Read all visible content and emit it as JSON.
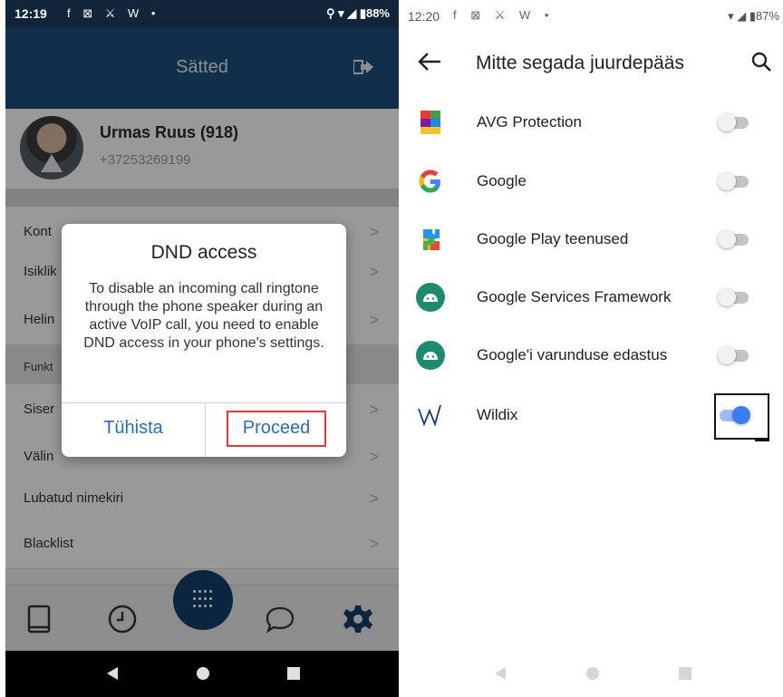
{
  "left_phone": {
    "status_bar": {
      "time": "12:19",
      "icons": "f ⊠ ⚔ W •",
      "right": "⚲ ▾ ◢ ▮88%"
    },
    "app_bar": {
      "title": "Sätted"
    },
    "profile": {
      "name": "Urmas Ruus (918)",
      "phone": "+37253269199"
    },
    "rows": [
      {
        "label": "Kont"
      },
      {
        "label": "Isiklik"
      },
      {
        "label": "Helin"
      }
    ],
    "section_label": "Funkt",
    "rows2": [
      {
        "label": "Siser"
      },
      {
        "label": "Välin"
      },
      {
        "label": "Lubatud nimekiri"
      },
      {
        "label": "Blacklist"
      }
    ],
    "dialog": {
      "title": "DND access",
      "body": "To disable an incoming call ringtone through the phone speaker during an active VoIP call, you need to enable DND access in your phone's settings.",
      "cancel_label": "Tühista",
      "proceed_label": "Proceed"
    },
    "tabs": [
      "book-icon",
      "clock-icon",
      "dialpad-icon",
      "chat-icon",
      "gear-icon"
    ],
    "colors": {
      "app_bar": "#1d4f7d",
      "status_bar": "#11243a",
      "fab": "#123f66",
      "highlight": "#e0383c"
    }
  },
  "right_phone": {
    "status_bar": {
      "time": "12:20",
      "icons": "f ⊠ ⚔ W •",
      "right": "▾ ◢ ▮87%"
    },
    "app_bar": {
      "title": "Mitte segada juurdepääs"
    },
    "apps": [
      {
        "name": "AVG Protection",
        "icon": "avg-icon",
        "enabled": false
      },
      {
        "name": "Google",
        "icon": "google-icon",
        "enabled": false
      },
      {
        "name": "Google Play teenused",
        "icon": "google-play-services-icon",
        "enabled": false
      },
      {
        "name": "Google Services Framework",
        "icon": "android-icon",
        "enabled": false
      },
      {
        "name": "Google'i varunduse edastus",
        "icon": "android-icon",
        "enabled": false
      },
      {
        "name": "Wildix",
        "icon": "wildix-icon",
        "enabled": true
      }
    ],
    "colors": {
      "switch_on": "#3a7df0",
      "android": "#1e8a6e"
    }
  }
}
